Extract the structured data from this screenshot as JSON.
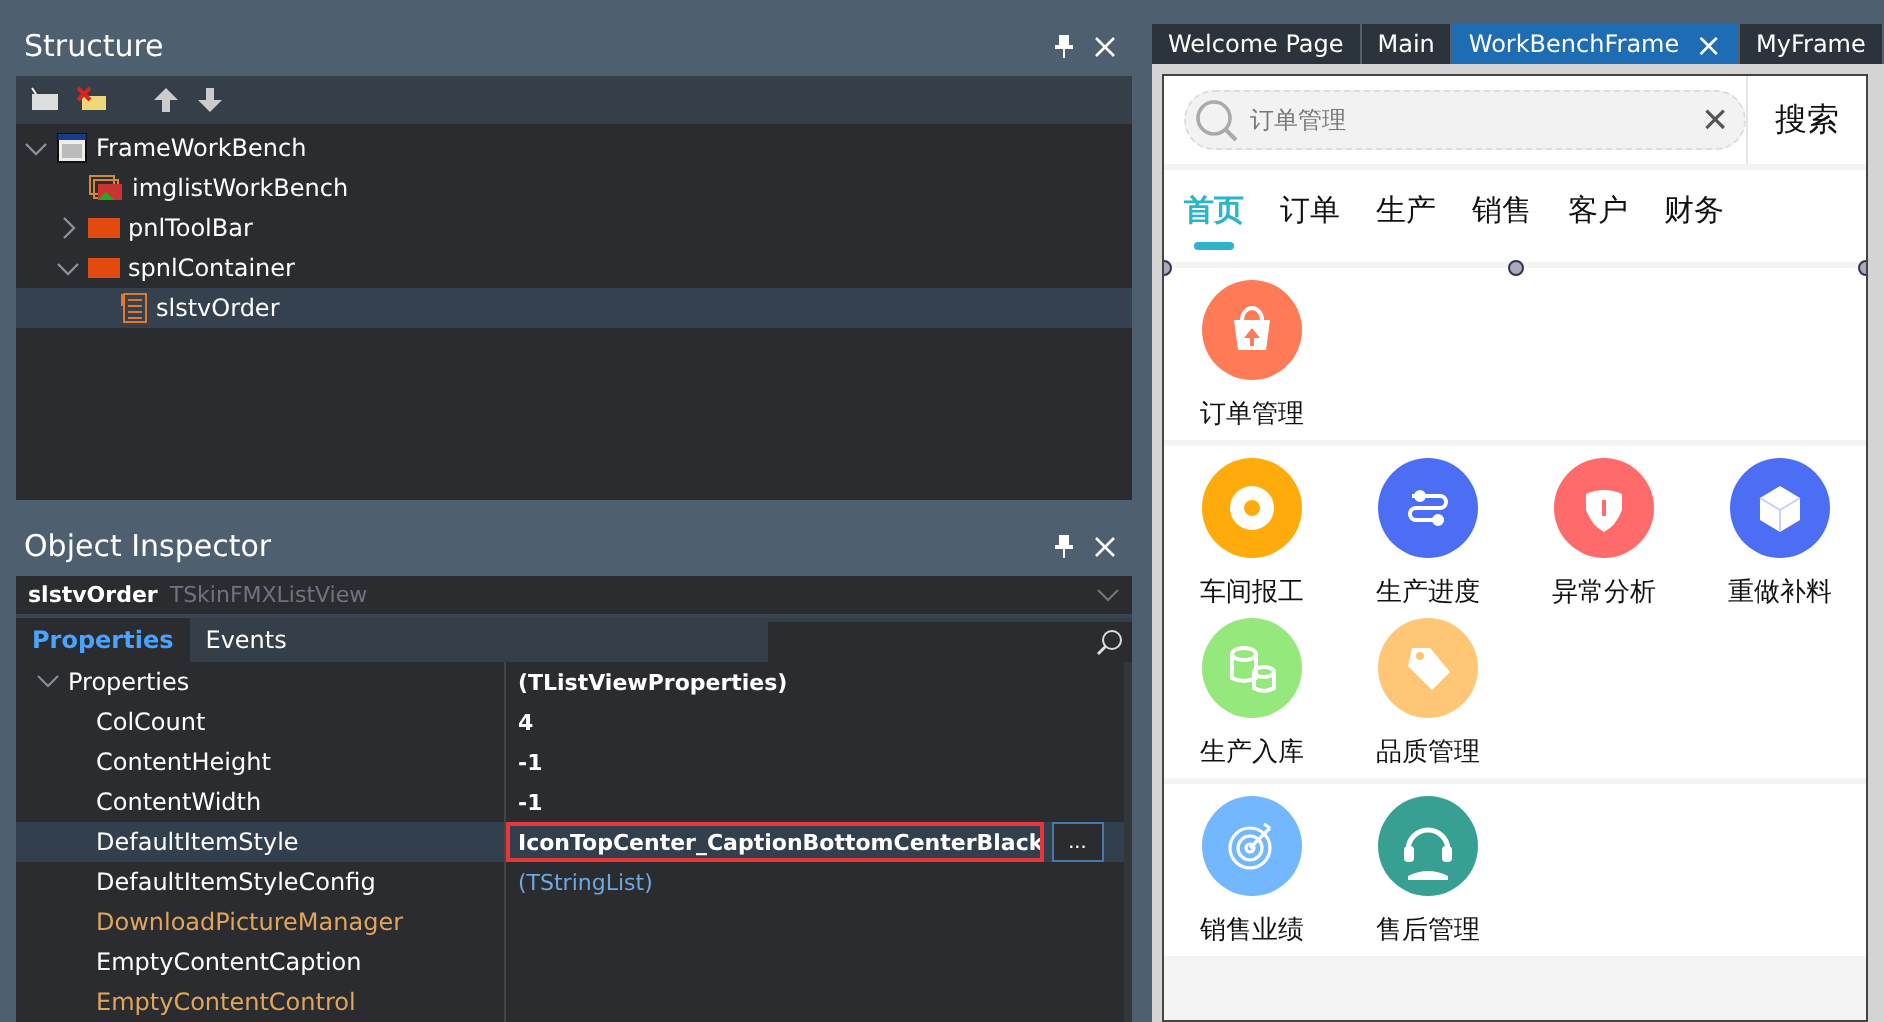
{
  "structure": {
    "title": "Structure",
    "tree": [
      {
        "label": "FrameWorkBench",
        "kind": "form",
        "expanded": true,
        "selected": false,
        "children": [
          {
            "label": "imglistWorkBench",
            "kind": "imagelist",
            "selected": false
          },
          {
            "label": "pnlToolBar",
            "kind": "panel",
            "expanded": false,
            "selected": false
          },
          {
            "label": "spnlContainer",
            "kind": "panel",
            "expanded": true,
            "selected": false,
            "children": [
              {
                "label": "slstvOrder",
                "kind": "listview",
                "selected": true
              }
            ]
          }
        ]
      }
    ]
  },
  "inspector": {
    "title": "Object Inspector",
    "object_name": "slstvOrder",
    "object_type": "TSkinFMXListView",
    "tabs": [
      {
        "label": "Properties",
        "selected": true
      },
      {
        "label": "Events",
        "selected": false
      }
    ],
    "rows": [
      {
        "name": "Properties",
        "value": "(TListViewProperties)",
        "kind": "group",
        "selected": false
      },
      {
        "name": "ColCount",
        "value": "4",
        "kind": "plain",
        "selected": false
      },
      {
        "name": "ContentHeight",
        "value": "-1",
        "kind": "plain",
        "selected": false
      },
      {
        "name": "ContentWidth",
        "value": "-1",
        "kind": "plain",
        "selected": false
      },
      {
        "name": "DefaultItemStyle",
        "value": "IconTopCenter_CaptionBottomCenterBlack",
        "kind": "plain",
        "selected": true,
        "button": "..."
      },
      {
        "name": "DefaultItemStyleConfig",
        "value": "(TStringList)",
        "kind": "object",
        "selected": false
      },
      {
        "name": "DownloadPictureManager",
        "value": "",
        "kind": "reference",
        "selected": false
      },
      {
        "name": "EmptyContentCaption",
        "value": "",
        "kind": "plain",
        "selected": false
      },
      {
        "name": "EmptyContentControl",
        "value": "",
        "kind": "reference",
        "selected": false
      }
    ]
  },
  "editor_tabs": [
    {
      "label": "Welcome Page",
      "selected": false
    },
    {
      "label": "Main",
      "selected": false
    },
    {
      "label": "WorkBenchFrame",
      "selected": true,
      "close": "×"
    },
    {
      "label": "MyFrame",
      "selected": false
    }
  ],
  "form": {
    "search": {
      "placeholder": "订单管理",
      "clear": "×",
      "button": "搜索"
    },
    "tabs": [
      {
        "label": "首页",
        "selected": true
      },
      {
        "label": "订单",
        "selected": false
      },
      {
        "label": "生产",
        "selected": false
      },
      {
        "label": "销售",
        "selected": false
      },
      {
        "label": "客户",
        "selected": false
      },
      {
        "label": "财务",
        "selected": false
      }
    ],
    "sections": [
      {
        "items": [
          {
            "label": "订单管理",
            "kind": "bag",
            "color": "#ff7b57"
          }
        ]
      },
      {
        "items": [
          {
            "label": "车间报工",
            "kind": "gear",
            "color": "#ffab0b"
          },
          {
            "label": "生产进度",
            "kind": "route",
            "color": "#4c6ef5"
          },
          {
            "label": "异常分析",
            "kind": "alert",
            "color": "#ff6b6b"
          },
          {
            "label": "重做补料",
            "kind": "cube",
            "color": "#4c6ef5"
          },
          {
            "label": "生产入库",
            "kind": "coins",
            "color": "#95e87b"
          },
          {
            "label": "品质管理",
            "kind": "tag",
            "color": "#ffc675"
          }
        ]
      },
      {
        "items": [
          {
            "label": "销售业绩",
            "kind": "target",
            "color": "#73b7ff"
          },
          {
            "label": "售后管理",
            "kind": "headset",
            "color": "#38a092"
          }
        ]
      }
    ]
  }
}
